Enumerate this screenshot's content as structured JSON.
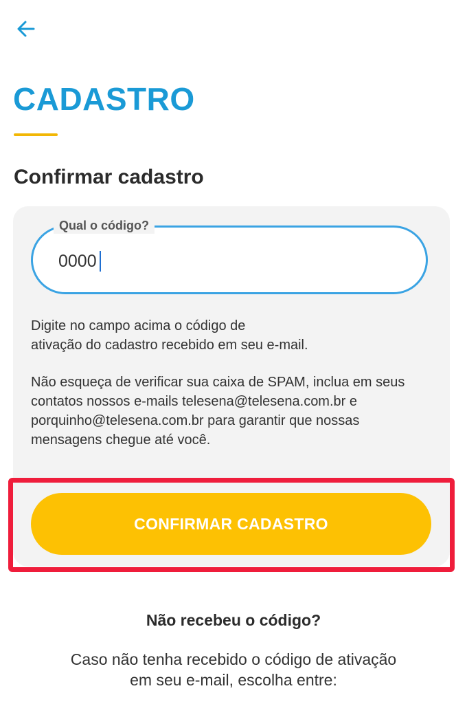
{
  "header": {
    "back_icon": "arrow-left-icon",
    "title": "CADASTRO",
    "accent_color": "#1a9ad6",
    "underline_color": "#f2b705"
  },
  "section": {
    "title": "Confirmar cadastro"
  },
  "code_field": {
    "label": "Qual o código?",
    "value": "0000"
  },
  "help": {
    "instruction_line1": "Digite no campo acima o código de",
    "instruction_line2": "ativação do cadastro recebido em seu e-mail.",
    "spam_line1": "Não esqueça de verificar sua caixa de SPAM, inclua em seus",
    "spam_line2": "contatos nossos e-mails telesena@telesena.com.br e",
    "spam_line3": "porquinho@telesena.com.br para garantir que nossas",
    "spam_line4": "mensagens chegue até você."
  },
  "confirm_button": {
    "label": "CONFIRMAR CADASTRO",
    "color": "#fdc103"
  },
  "highlight": {
    "color": "#ef1d3b"
  },
  "resend": {
    "title": "Não recebeu o código?",
    "text_line1": "Caso não tenha recebido o código de ativação",
    "text_line2": "em seu e-mail, escolha entre:"
  }
}
